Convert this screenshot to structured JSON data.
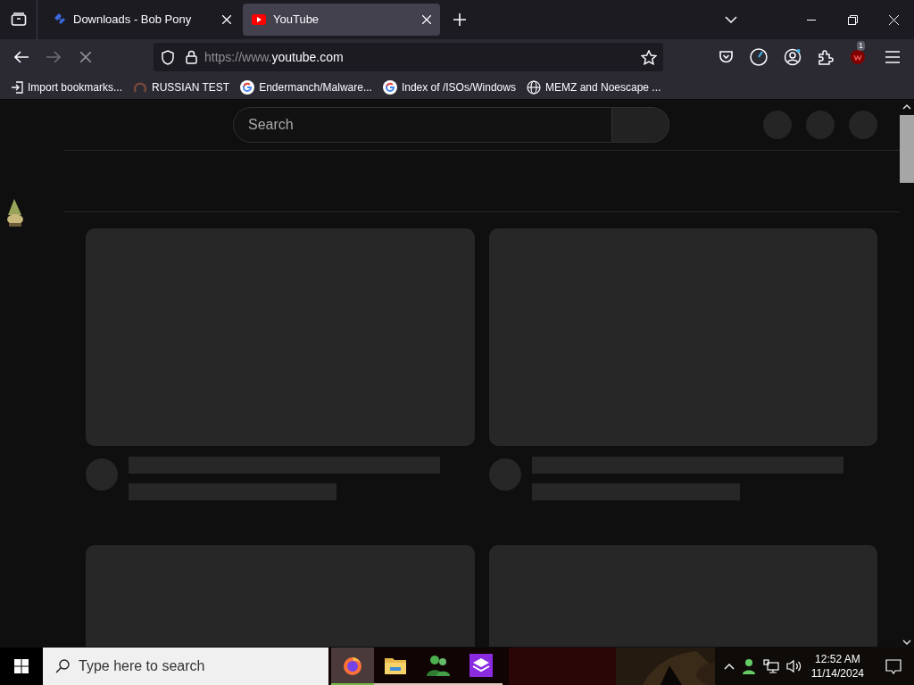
{
  "tabs": [
    {
      "title": "Downloads - Bob Pony",
      "kind": "puzzle",
      "selected": false
    },
    {
      "title": "YouTube",
      "kind": "youtube",
      "selected": true
    }
  ],
  "address_bar": {
    "url_prefix": "https://www.",
    "url_domain": "youtube.com"
  },
  "toolbar": {
    "extension_badge": "1"
  },
  "bookmarks": [
    {
      "label": "Import bookmarks...",
      "kind": "import"
    },
    {
      "label": "RUSSIAN TEST",
      "kind": "swirl"
    },
    {
      "label": "Endermanch/Malware...",
      "kind": "google"
    },
    {
      "label": "Index of /ISOs/Windows",
      "kind": "google"
    },
    {
      "label": "MEMZ and Noescape ...",
      "kind": "globe"
    }
  ],
  "page": {
    "search_placeholder": "Search",
    "video_placeholders": [
      {
        "kind": "skeleton"
      },
      {
        "kind": "skeleton"
      },
      {
        "kind": "thumbnail"
      },
      {
        "kind": "thumbnail"
      }
    ]
  },
  "taskbar": {
    "search_placeholder": "Type here to search",
    "apps": [
      {
        "kind": "firefox",
        "selected": true
      },
      {
        "kind": "folder",
        "selected": false
      },
      {
        "kind": "people",
        "selected": false
      },
      {
        "kind": "box",
        "selected": false
      }
    ],
    "time": "12:52 AM",
    "date": "11/14/2024"
  }
}
